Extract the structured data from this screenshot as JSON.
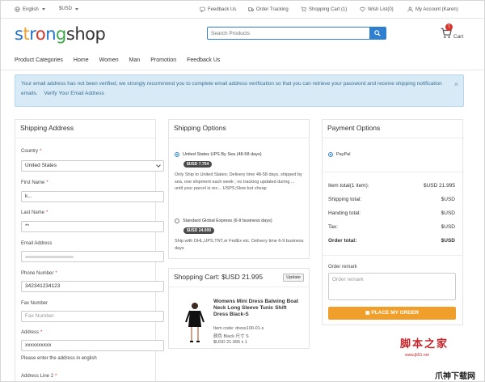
{
  "topbar": {
    "language": "English",
    "currency": "$USD",
    "feedback": "Feedback Us",
    "order_tracking": "Order Tracking",
    "shopping_cart": "Shopping Cart (1)",
    "wish_list": "Wish List(0)",
    "my_account": "My Account (Karen)"
  },
  "header": {
    "logo": {
      "letters": [
        {
          "ch": "s",
          "color": "#1e73c9"
        },
        {
          "ch": "t",
          "color": "#f0a02a"
        },
        {
          "ch": "r",
          "color": "#1e73c9"
        },
        {
          "ch": "o",
          "color": "#d9332c"
        },
        {
          "ch": "n",
          "color": "#1e73c9"
        },
        {
          "ch": "g",
          "color": "#3da84a"
        },
        {
          "ch": "shop",
          "color": "#333333"
        }
      ]
    },
    "search_placeholder": "Search Products",
    "cart_count": "1",
    "cart_label": "Cart"
  },
  "nav": {
    "items": [
      "Product Categories",
      "Home",
      "Women",
      "Man",
      "Promotion",
      "Feedback Us"
    ]
  },
  "alert": {
    "message": "Your email address has not been verified, we strongly recommend you to complete email address verification so that you can retrieve your password and receive shipping notification emails.",
    "link": "Verify Your Email Address",
    "close": "×"
  },
  "shipping_address": {
    "title": "Shipping Address",
    "country_label": "Country",
    "country_value": "United States",
    "first_name_label": "First Name",
    "first_name_value": "k...",
    "last_name_label": "Last Name",
    "last_name_value": "**",
    "email_label": "Email Address",
    "email_value": "",
    "phone_label": "Phone Number",
    "phone_value": "342341234123",
    "fax_label": "Fax Number",
    "fax_placeholder": "Fax Number",
    "address_label": "Address",
    "address_value": "xxxxxxxxxx",
    "address_hint": "Please enter the address in english",
    "address2_label": "Address Line 2"
  },
  "shipping_options": {
    "title": "Shipping Options",
    "options": [
      {
        "name": "United States UPS By Sea (48-58 days)",
        "price": "$USD 7.754",
        "selected": true,
        "desc": "Only Ship to United States; Delivery time 48-58 days, shipped by sea, one shipment each week ; no tracking updated during ... until your parcel is rec... USPS;Slow but cheap"
      },
      {
        "name": "Standard Global Express (6-9 business days)",
        "price": "$USD 24.000",
        "selected": false,
        "desc": "Ship with DHL,UPS,TNT,or FedEx etc. Delivery time 6-9 business days"
      }
    ]
  },
  "cart_panel": {
    "title": "Shopping Cart: $USD 21.995",
    "update": "Update",
    "product": {
      "name": "Womens Mini Dress Batwing Boat Neck Long Sleeve Tunic Shift Dress Black-S",
      "item_code": "Item code: dress100-01-s",
      "color_size": "颜色 Black 尺寸 S",
      "price_qty": "$USD 21.995 x 1"
    }
  },
  "payment": {
    "title": "Payment Options",
    "method": "PayPal",
    "rows": [
      {
        "label": "Item total(1 item):",
        "value": "$USD 21.995"
      },
      {
        "label": "Shipping total:",
        "value": "$USD"
      },
      {
        "label": "Handing total:",
        "value": "$USD"
      },
      {
        "label": "Tax:",
        "value": "$USD"
      },
      {
        "label": "Order total:",
        "value": "$USD"
      }
    ],
    "remark_label": "Order remark",
    "remark_placeholder": "Order remark",
    "place_order": "PLACE MY ORDER"
  },
  "watermark": {
    "title": "脚本之家",
    "url": "www.jb51.net",
    "corner": "爪神下载网"
  },
  "colors": {
    "accent": "#2f7fd1",
    "alert_bg": "#d8eaf6",
    "order_button": "#f0a02a",
    "required": "#d9332c"
  }
}
